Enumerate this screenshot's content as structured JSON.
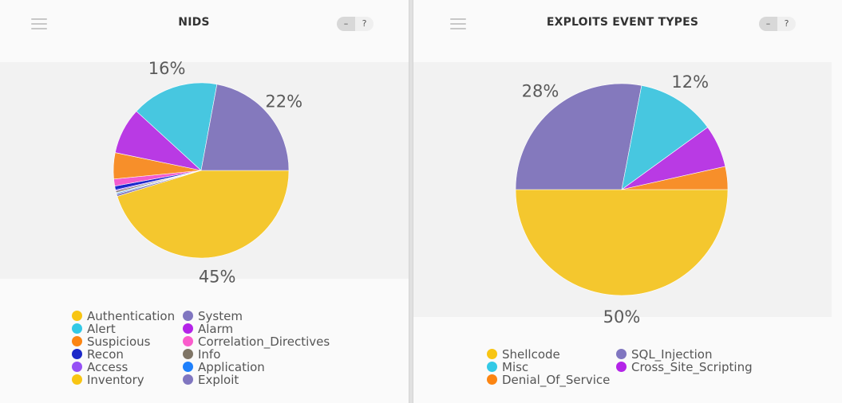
{
  "panels": [
    {
      "title": "NIDS",
      "minimize_label": "–",
      "help_label": "?",
      "menu_icon": "hamburger-menu-icon"
    },
    {
      "title": "EXPLOITS EVENT TYPES",
      "minimize_label": "–",
      "help_label": "?",
      "menu_icon": "hamburger-menu-icon"
    }
  ],
  "chart_data": [
    {
      "type": "pie",
      "title": "NIDS",
      "legend_position": "bottom",
      "slices": [
        {
          "label": "Authentication",
          "value": 45,
          "color": "#f4c72e"
        },
        {
          "label": "Exploit",
          "value": 0.4,
          "color": "#8479bd"
        },
        {
          "label": "Application",
          "value": 0.2,
          "color": "#1e7ff0"
        },
        {
          "label": "Inventory",
          "value": 0.1,
          "color": "#f4c72e"
        },
        {
          "label": "Info",
          "value": 0.3,
          "color": "#7f7566"
        },
        {
          "label": "Access",
          "value": 0.2,
          "color": "#9650f0"
        },
        {
          "label": "Recon",
          "value": 0.7,
          "color": "#1a28cc"
        },
        {
          "label": "Correlation_Directives",
          "value": 1.3,
          "color": "#f25ccf"
        },
        {
          "label": "Suspicious",
          "value": 4.8,
          "color": "#f78f2a"
        },
        {
          "label": "Alarm",
          "value": 8.5,
          "color": "#b93ae4"
        },
        {
          "label": "Alert",
          "value": 16,
          "color": "#47c7e0"
        },
        {
          "label": "System",
          "value": 22,
          "color": "#8479bd"
        }
      ],
      "data_labels": [
        {
          "text": "45%",
          "slice": "Authentication"
        },
        {
          "text": "22%",
          "slice": "System"
        },
        {
          "text": "16%",
          "slice": "Alert"
        }
      ],
      "legend": [
        {
          "label": "Authentication",
          "color": "#f8c513"
        },
        {
          "label": "System",
          "color": "#8076c0"
        },
        {
          "label": "Alert",
          "color": "#33c9e6"
        },
        {
          "label": "Alarm",
          "color": "#b424e8"
        },
        {
          "label": "Suspicious",
          "color": "#fc8512"
        },
        {
          "label": "Correlation_Directives",
          "color": "#fa5ccc"
        },
        {
          "label": "Recon",
          "color": "#1c28c8"
        },
        {
          "label": "Info",
          "color": "#7f7566"
        },
        {
          "label": "Access",
          "color": "#9650f5"
        },
        {
          "label": "Application",
          "color": "#1e80fc"
        },
        {
          "label": "Inventory",
          "color": "#f8c513"
        },
        {
          "label": "Exploit",
          "color": "#8076c0"
        }
      ]
    },
    {
      "type": "pie",
      "title": "EXPLOITS EVENT TYPES",
      "legend_position": "bottom",
      "slices": [
        {
          "label": "Shellcode",
          "value": 50,
          "color": "#f4c72e"
        },
        {
          "label": "SQL_Injection",
          "value": 28,
          "color": "#8479bd"
        },
        {
          "label": "Misc",
          "value": 12,
          "color": "#47c7e0"
        },
        {
          "label": "Cross_Site_Scripting",
          "value": 6.5,
          "color": "#b93ae4"
        },
        {
          "label": "Denial_Of_Service",
          "value": 3.5,
          "color": "#f78f2a"
        }
      ],
      "data_labels": [
        {
          "text": "50%",
          "slice": "Shellcode"
        },
        {
          "text": "28%",
          "slice": "SQL_Injection"
        },
        {
          "text": "12%",
          "slice": "Misc"
        }
      ],
      "legend": [
        {
          "label": "Shellcode",
          "color": "#f8c513"
        },
        {
          "label": "SQL_Injection",
          "color": "#8076c0"
        },
        {
          "label": "Misc",
          "color": "#33c9e6"
        },
        {
          "label": "Cross_Site_Scripting",
          "color": "#b424e8"
        },
        {
          "label": "Denial_Of_Service",
          "color": "#fc8512"
        }
      ]
    }
  ]
}
